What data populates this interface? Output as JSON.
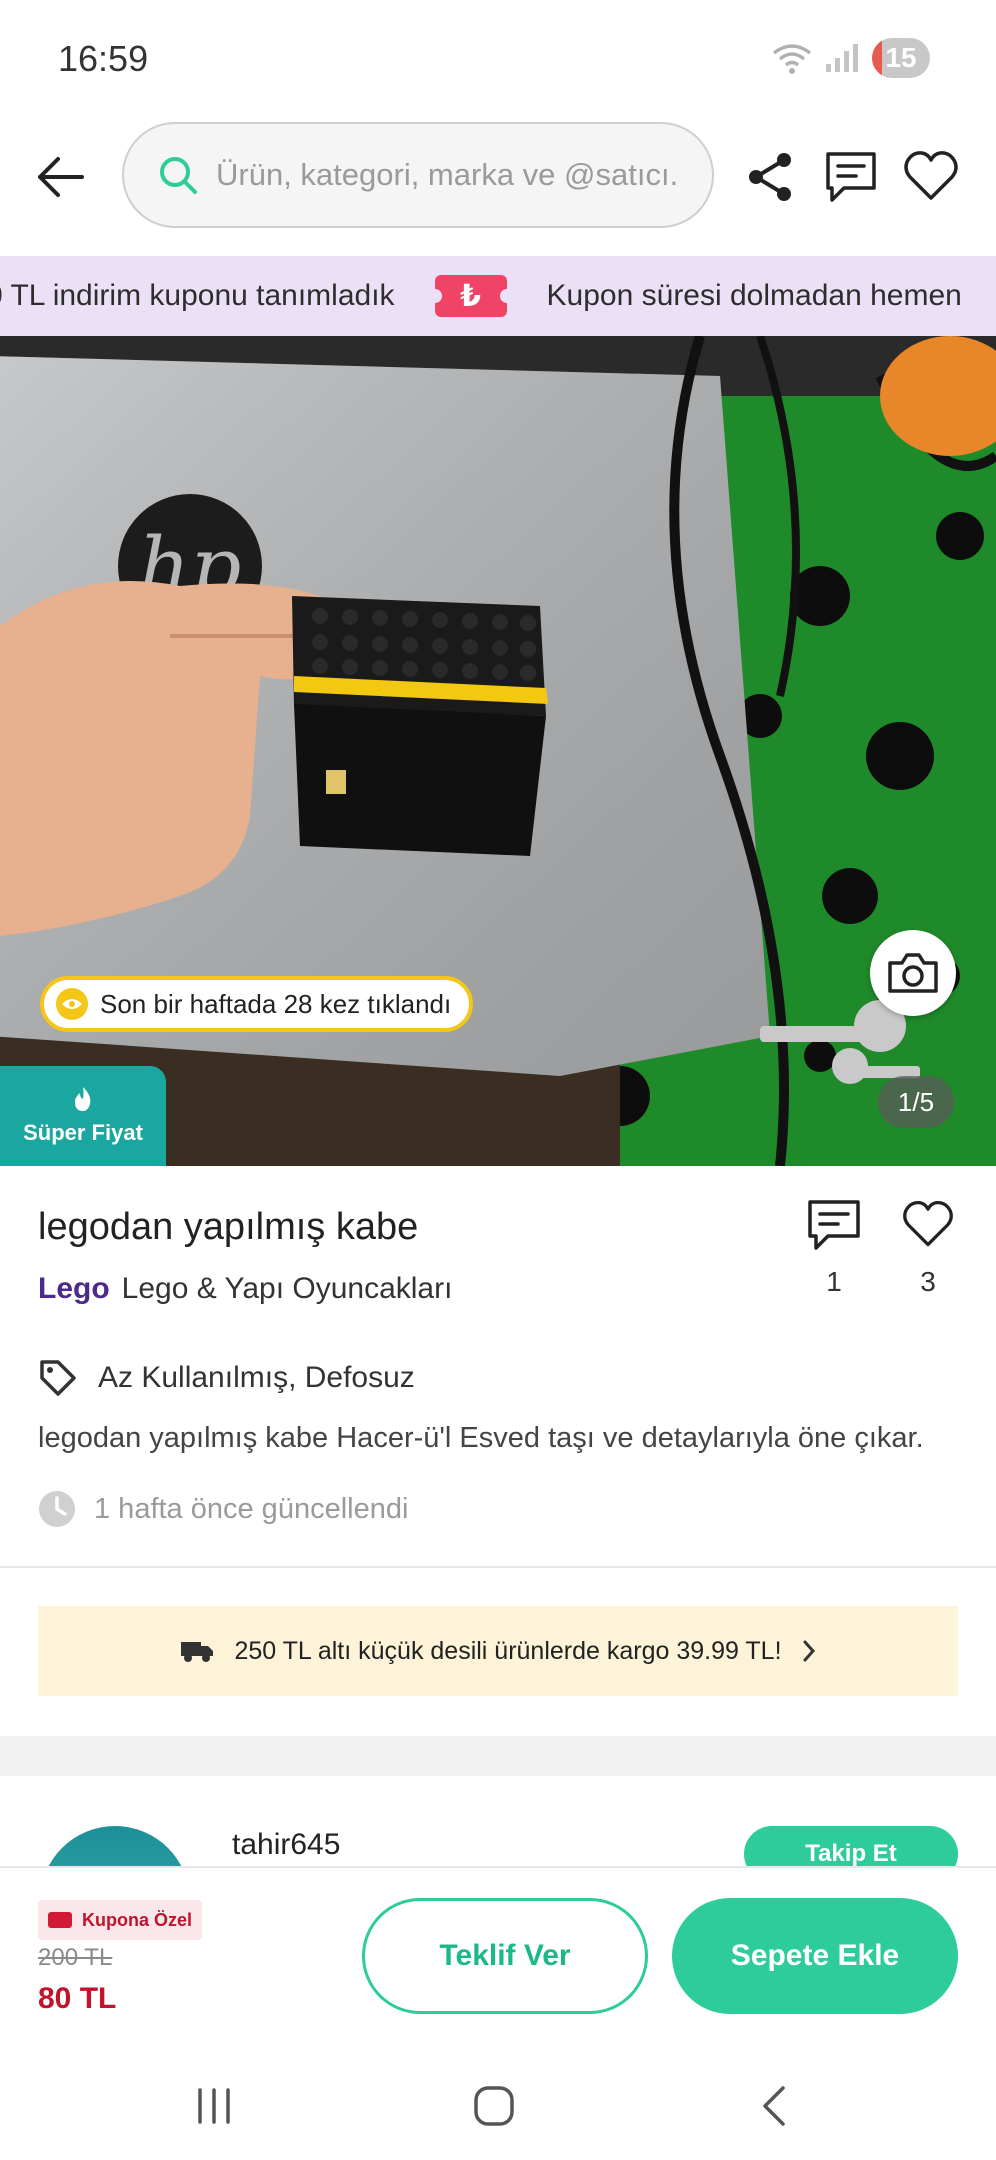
{
  "status_bar": {
    "time": "16:59",
    "battery": "15"
  },
  "search": {
    "placeholder": "Ürün, kategori, marka ve @satıcı..."
  },
  "coupon_banner": {
    "text_left": "0 TL indirim kuponu tanımladık",
    "ticket_symbol": "₺",
    "text_right": "Kupon süresi dolmadan hemen"
  },
  "image": {
    "click_badge": "Son bir haftada 28 kez tıklandı",
    "page_indicator": "1/5",
    "super_price": "Süper Fiyat"
  },
  "product": {
    "title": "legodan yapılmış kabe",
    "brand": "Lego",
    "category": "Lego & Yapı Oyuncakları",
    "comments_count": "1",
    "likes_count": "3",
    "condition": "Az Kullanılmış, Defosuz",
    "description": "legodan yapılmış kabe Hacer-ü'l Esved taşı ve detaylarıyla öne çıkar.",
    "updated": "1 hafta önce güncellendi"
  },
  "shipping": {
    "text": "250 TL altı küçük desili ürünlerde kargo 39.99 TL!"
  },
  "seller": {
    "name": "tahir645",
    "follow_label": "Takip Et"
  },
  "bottom_bar": {
    "coupon_tag": "Kupona Özel",
    "old_price": "200 TL",
    "new_price": "80 TL",
    "offer_label": "Teklif Ver",
    "cart_label": "Sepete Ekle"
  },
  "colors": {
    "accent": "#2ecc9a",
    "brand_purple": "#4b2a8a",
    "price_red": "#c0142c",
    "coupon_banner_bg": "#ece0f7",
    "shipping_bg": "#fdf3d8",
    "super_price_bg": "#1aa7a0"
  },
  "icons": [
    "back-arrow-icon",
    "search-icon",
    "share-icon",
    "message-icon",
    "heart-icon",
    "camera-icon",
    "eye-icon",
    "tag-icon",
    "clock-icon",
    "truck-icon",
    "chevron-right-icon"
  ]
}
